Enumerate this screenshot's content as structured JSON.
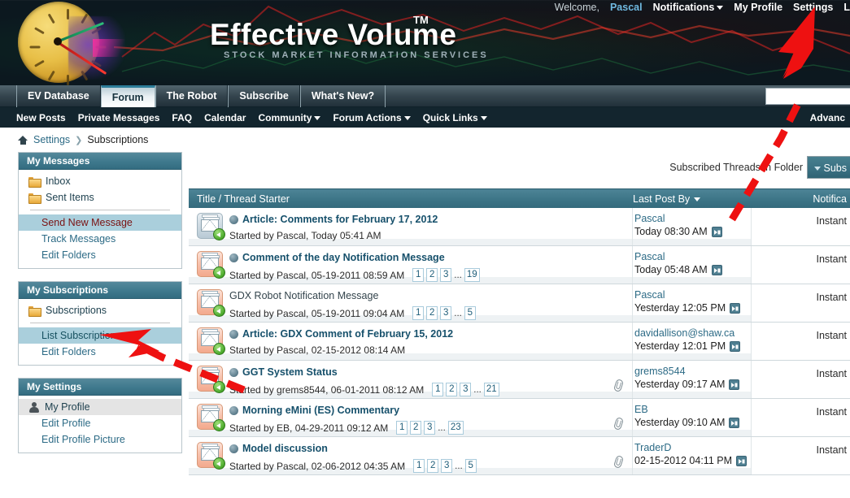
{
  "header": {
    "brand": "Effective Volume",
    "brand_tm": "TM",
    "brand_sub": "STOCK MARKET INFORMATION SERVICES",
    "welcome_label": "Welcome,",
    "username": "Pascal",
    "nav": [
      {
        "label": "Notifications",
        "caret": true
      },
      {
        "label": "My Profile",
        "caret": false
      },
      {
        "label": "Settings",
        "caret": false
      },
      {
        "label": "L",
        "caret": false
      }
    ]
  },
  "tabs": [
    {
      "label": "EV Database",
      "active": false
    },
    {
      "label": "Forum",
      "active": true
    },
    {
      "label": "The Robot",
      "active": false
    },
    {
      "label": "Subscribe",
      "active": false
    },
    {
      "label": "What's New?",
      "active": false
    }
  ],
  "subnav": {
    "items": [
      {
        "label": "New Posts",
        "caret": false
      },
      {
        "label": "Private Messages",
        "caret": false
      },
      {
        "label": "FAQ",
        "caret": false
      },
      {
        "label": "Calendar",
        "caret": false
      },
      {
        "label": "Community",
        "caret": true
      },
      {
        "label": "Forum Actions",
        "caret": true
      },
      {
        "label": "Quick Links",
        "caret": true
      }
    ],
    "advanced": "Advanc"
  },
  "breadcrumb": {
    "home_icon": "home-icon",
    "settings": "Settings",
    "separator": "❯",
    "current": "Subscriptions"
  },
  "sidebar": {
    "panels": [
      {
        "title": "My Messages",
        "items": [
          {
            "label": "Inbox",
            "icon": "folder-icon",
            "style": "folder"
          },
          {
            "label": "Sent Items",
            "icon": "folder-icon",
            "style": "folder"
          },
          {
            "divider": true
          },
          {
            "label": "Send New Message",
            "style": "sub-selected"
          },
          {
            "label": "Track Messages",
            "style": "sub"
          },
          {
            "label": "Edit Folders",
            "style": "sub"
          }
        ]
      },
      {
        "title": "My Subscriptions",
        "items": [
          {
            "label": "Subscriptions",
            "icon": "folder-icon",
            "style": "folder"
          },
          {
            "divider": true
          },
          {
            "label": "List Subscriptions",
            "style": "sub-selected2"
          },
          {
            "label": "Edit Folders",
            "style": "sub"
          }
        ]
      },
      {
        "title": "My Settings",
        "items": [
          {
            "label": "My Profile",
            "icon": "user-icon",
            "style": "user-selected"
          },
          {
            "label": "Edit Profile",
            "style": "sub"
          },
          {
            "label": "Edit Profile Picture",
            "style": "sub"
          }
        ]
      }
    ]
  },
  "main": {
    "folder_label": "Subscribed Threads in Folder",
    "subs_button": "Subs",
    "columns": {
      "title": "Title / Thread Starter",
      "last_post": "Last Post By",
      "notification": "Notifica"
    },
    "rows": [
      {
        "icon_state": "read",
        "sticky": true,
        "title": "Article: Comments for February 17, 2012",
        "title_bold": true,
        "started_by": "Started by Pascal, Today 05:41 AM",
        "pages": [],
        "total_pages": "",
        "attachment": false,
        "last_post_user": "Pascal",
        "last_post_time": "Today 08:30 AM",
        "goto_icon": true,
        "notification": "Instant"
      },
      {
        "icon_state": "unread",
        "sticky": true,
        "title": "Comment of the day Notification Message",
        "title_bold": true,
        "started_by": "Started by Pascal, 05-19-2011 08:59 AM",
        "pages": [
          "1",
          "2",
          "3"
        ],
        "total_pages": "19",
        "attachment": false,
        "last_post_user": "Pascal",
        "last_post_time": "Today 05:48 AM",
        "goto_icon": true,
        "notification": "Instant"
      },
      {
        "icon_state": "unread",
        "sticky": false,
        "title": "GDX Robot Notification Message",
        "title_bold": false,
        "started_by": "Started by Pascal, 05-19-2011 09:04 AM",
        "pages": [
          "1",
          "2",
          "3"
        ],
        "total_pages": "5",
        "attachment": false,
        "last_post_user": "Pascal",
        "last_post_time": "Yesterday 12:05 PM",
        "goto_icon": true,
        "notification": "Instant"
      },
      {
        "icon_state": "unread",
        "sticky": true,
        "title": "Article: GDX Comment of February 15, 2012",
        "title_bold": true,
        "started_by": "Started by Pascal, 02-15-2012 08:14 AM",
        "pages": [],
        "total_pages": "",
        "attachment": false,
        "last_post_user": "davidallison@shaw.ca",
        "last_post_time": "Yesterday 12:01 PM",
        "goto_icon": true,
        "notification": "Instant"
      },
      {
        "icon_state": "unread",
        "sticky": true,
        "title": "GGT System Status",
        "title_bold": true,
        "started_by": "Started by grems8544, 06-01-2011 08:12 AM",
        "pages": [
          "1",
          "2",
          "3"
        ],
        "total_pages": "21",
        "attachment": true,
        "last_post_user": "grems8544",
        "last_post_time": "Yesterday 09:17 AM",
        "goto_icon": true,
        "notification": "Instant"
      },
      {
        "icon_state": "unread",
        "sticky": true,
        "title": "Morning eMini (ES) Commentary",
        "title_bold": true,
        "started_by": "Started by EB, 04-29-2011 09:12 AM",
        "pages": [
          "1",
          "2",
          "3"
        ],
        "total_pages": "23",
        "attachment": true,
        "last_post_user": "EB",
        "last_post_time": "Yesterday 09:10 AM",
        "goto_icon": true,
        "notification": "Instant"
      },
      {
        "icon_state": "unread",
        "sticky": true,
        "title": "Model discussion",
        "title_bold": true,
        "started_by": "Started by Pascal, 02-06-2012 04:35 AM",
        "pages": [
          "1",
          "2",
          "3"
        ],
        "total_pages": "5",
        "attachment": true,
        "last_post_user": "TraderD",
        "last_post_time": "02-15-2012 04:11 PM",
        "goto_icon": true,
        "notification": "Instant"
      }
    ]
  },
  "annotations": {
    "arrow_color": "#ee1111",
    "arrow_to_settings": "arrow pointing to Settings link",
    "arrow_to_subscriptions": "arrow pointing to Subscriptions folder"
  },
  "colors": {
    "header_bg": "#0c181f",
    "panel_head": "#3f798d",
    "table_head": "#3d7587",
    "link": "#2d6b86",
    "title_link": "#16506b",
    "selected_row": "#aacfdc",
    "arrow_red": "#ee1111"
  }
}
